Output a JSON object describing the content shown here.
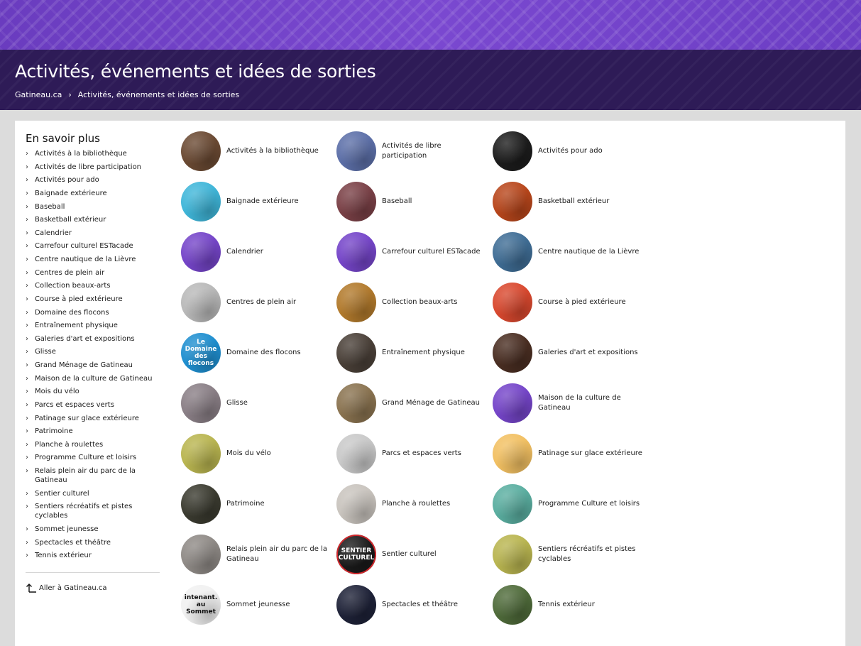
{
  "header": {
    "title": "Activités, événements et idées de sorties",
    "breadcrumb": [
      "Gatineau.ca",
      "Activités, événements et idées de sorties"
    ],
    "breadcrumb_separator": "›",
    "colors": {
      "banner": "#7a48d0",
      "titlebar": "#2e1b57"
    }
  },
  "sidebar": {
    "title": "En savoir plus",
    "items": [
      "Activités à la bibliothèque",
      "Activités de libre participation",
      "Activités pour ado",
      "Baignade extérieure",
      "Baseball",
      "Basketball extérieur",
      "Calendrier",
      "Carrefour culturel ESTacade",
      "Centre nautique de la Lièvre",
      "Centres de plein air",
      "Collection beaux-arts",
      "Course à pied extérieure",
      "Domaine des flocons",
      "Entraînement physique",
      "Galeries d'art et expositions",
      "Glisse",
      "Grand Ménage de Gatineau",
      "Maison de la culture de Gatineau",
      "Mois du vélo",
      "Parcs et espaces verts",
      "Patinage sur glace extérieure",
      "Patrimoine",
      "Planche à roulettes",
      "Programme Culture et loisirs",
      "Relais plein air du parc de la Gatineau",
      "Sentier culturel",
      "Sentiers récréatifs et pistes cyclables",
      "Sommet jeunesse",
      "Spectacles et théâtre",
      "Tennis extérieur"
    ],
    "chevron": "›",
    "goto_link": "Aller à Gatineau.ca"
  },
  "tiles": [
    {
      "label": "Activités à la bibliothèque",
      "image": "library-books-photo",
      "color": "#6b4a33"
    },
    {
      "label": "Activités de libre participation",
      "image": "jump-rope-photo",
      "color": "#5c6fa8"
    },
    {
      "label": "Activités pour ado",
      "image": "teen-poster-photo",
      "color": "#1c1c1c"
    },
    {
      "label": "Baignade extérieure",
      "image": "pool-photo",
      "color": "#3fb6d9"
    },
    {
      "label": "Baseball",
      "image": "baseball-photo",
      "color": "#7a4046"
    },
    {
      "label": "Basketball extérieur",
      "image": "basketball-photo",
      "color": "#b8461b"
    },
    {
      "label": "Calendrier",
      "image": "purple-placeholder",
      "color": "#7545c9"
    },
    {
      "label": "Carrefour culturel ESTacade",
      "image": "purple-placeholder",
      "color": "#7545c9"
    },
    {
      "label": "Centre nautique de la Lièvre",
      "image": "water-photo",
      "color": "#3f6d95"
    },
    {
      "label": "Centres de plein air",
      "image": "skier-photo",
      "color": "#b9b9b9"
    },
    {
      "label": "Collection beaux-arts",
      "image": "art-photo",
      "color": "#b27a2c"
    },
    {
      "label": "Course à pied extérieure",
      "image": "running-track-photo",
      "color": "#d9482e"
    },
    {
      "label": "Domaine des flocons",
      "image": "domaine-logo",
      "color": "#1f8fd0",
      "mark": "Le Domaine des flocons"
    },
    {
      "label": "Entraînement physique",
      "image": "gym-photo",
      "color": "#4a4038"
    },
    {
      "label": "Galeries d'art et expositions",
      "image": "gallery-photo",
      "color": "#4a2e22"
    },
    {
      "label": "Glisse",
      "image": "sliding-photo",
      "color": "#8a7f86"
    },
    {
      "label": "Grand Ménage de Gatineau",
      "image": "cleanup-photo",
      "color": "#8a7350"
    },
    {
      "label": "Maison de la culture de Gatineau",
      "image": "purple-placeholder",
      "color": "#7545c9"
    },
    {
      "label": "Mois du vélo",
      "image": "bike-logo",
      "color": "#b9b550"
    },
    {
      "label": "Parcs et espaces verts",
      "image": "winter-park-photo",
      "color": "#c9c9c9"
    },
    {
      "label": "Patinage sur glace extérieure",
      "image": "skate-illustration",
      "color": "#f2c062"
    },
    {
      "label": "Patrimoine",
      "image": "heritage-house-photo",
      "color": "#3b3b30"
    },
    {
      "label": "Planche à roulettes",
      "image": "skateboard-photo",
      "color": "#c9c4be"
    },
    {
      "label": "Programme Culture et loisirs",
      "image": "program-cover-photo",
      "color": "#5aaea0"
    },
    {
      "label": "Relais plein air du parc de la Gatineau",
      "image": "outdoor-group-photo",
      "color": "#8f8a86"
    },
    {
      "label": "Sentier culturel",
      "image": "sentier-logo",
      "color": "#1a1a1a",
      "mark": "SENTIER CULTUREL"
    },
    {
      "label": "Sentiers récréatifs et pistes cyclables",
      "image": "bike-logo",
      "color": "#b9b550"
    },
    {
      "label": "Sommet jeunesse",
      "image": "sommet-logo",
      "color": "#f1f1f1",
      "mark": "intenant. au Sommet"
    },
    {
      "label": "Spectacles et théâtre",
      "image": "stage-photo",
      "color": "#1e2238"
    },
    {
      "label": "Tennis extérieur",
      "image": "tennis-photo",
      "color": "#4f6b3a"
    }
  ]
}
